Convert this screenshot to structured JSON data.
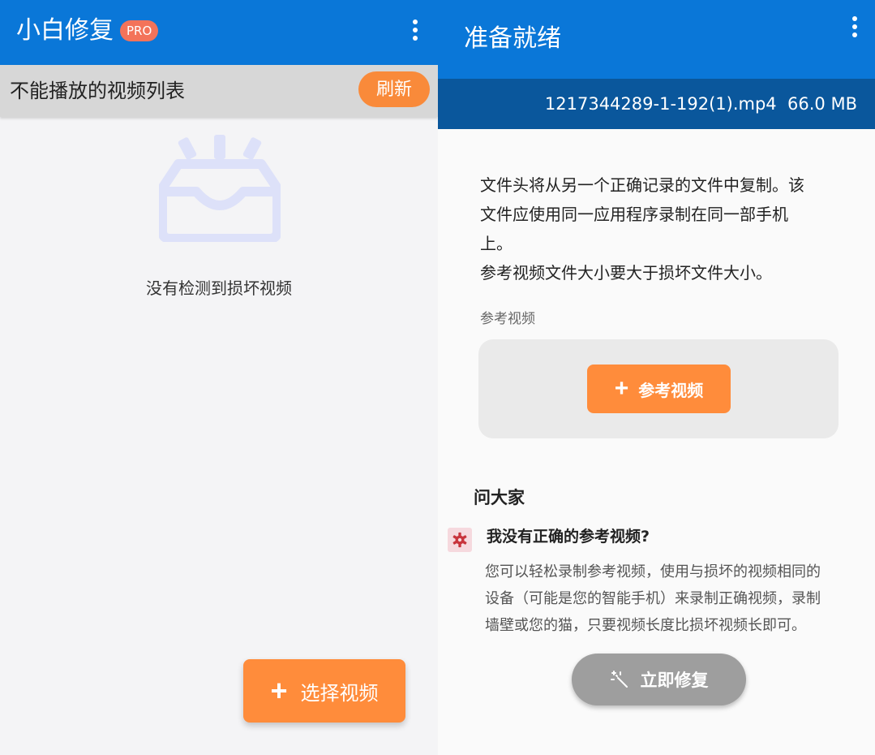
{
  "left_panel": {
    "app_title": "小白修复",
    "pro_badge": "PRO",
    "menu_icon": "more-vert-icon",
    "list_header": {
      "title": "不能播放的视频列表",
      "refresh_label": "刷新"
    },
    "empty_state": {
      "icon": "inbox-icon",
      "message": "没有检测到损坏视频"
    },
    "select_button": {
      "icon": "plus-icon",
      "label": "选择视频"
    }
  },
  "right_panel": {
    "title": "准备就绪",
    "menu_icon": "more-vert-icon",
    "file": {
      "name": "1217344289-1-192(1).mp4",
      "size": "66.0 MB"
    },
    "description": {
      "line1": "文件头将从另一个正确记录的文件中复制。该",
      "line2": "文件应使用同一应用程序录制在同一部手机",
      "line3": "上。",
      "line4": "参考视频文件大小要大于损坏文件大小。"
    },
    "reference": {
      "label": "参考视频",
      "button_label": "参考视频",
      "button_icon": "plus-icon"
    },
    "ask": {
      "title": "问大家",
      "faq_icon": "gear-icon",
      "question": "我没有正确的参考视频?",
      "answer_line1": "您可以轻松录制参考视频，使用与损坏的视频相同的",
      "answer_line2": "设备（可能是您的智能手机）来录制正确视频，录制",
      "answer_line3": "墙壁或您的猫，只要视频长度比损坏视频长即可。"
    },
    "repair_button": {
      "icon": "magic-wand-icon",
      "label": "立即修复"
    }
  },
  "colors": {
    "app_bar": "#0a77d8",
    "file_bar": "#0a579c",
    "accent_orange": "#ff8c3b",
    "pro_badge": "#f3735a",
    "disabled_button": "#9e9e9e",
    "empty_icon": "#dde1f9"
  }
}
